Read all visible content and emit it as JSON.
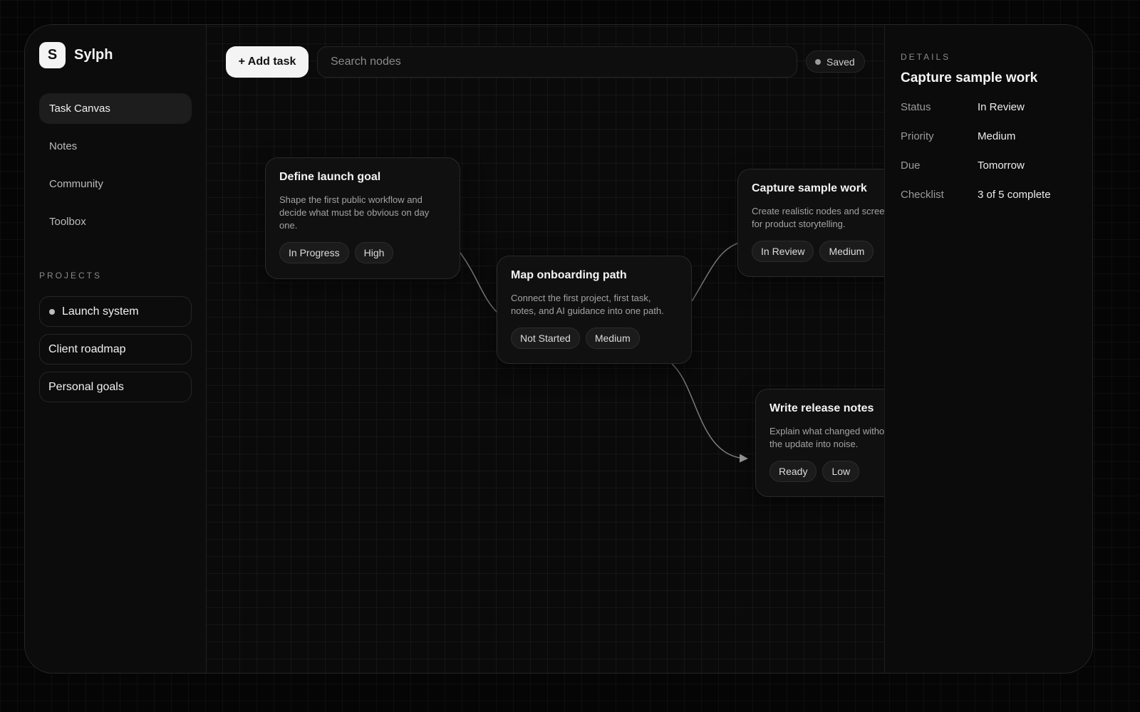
{
  "app": {
    "brand_initial": "S",
    "brand_name": "Sylph"
  },
  "nav": [
    {
      "label": "Task Canvas",
      "active": true
    },
    {
      "label": "Notes",
      "active": false
    },
    {
      "label": "Community",
      "active": false
    },
    {
      "label": "Toolbox",
      "active": false
    }
  ],
  "projects_label": "PROJECTS",
  "projects": [
    {
      "label": "Launch system",
      "active": true
    },
    {
      "label": "Client roadmap",
      "active": false
    },
    {
      "label": "Personal goals",
      "active": false
    }
  ],
  "toolbar": {
    "add_label": "+ Add task",
    "search_placeholder": "Search nodes",
    "saved_label": "Saved"
  },
  "cards": [
    {
      "title": "Define launch goal",
      "desc": "Shape the first public workflow and decide what must be obvious on day one.",
      "status": "In Progress",
      "priority": "High"
    },
    {
      "title": "Map onboarding path",
      "desc": "Connect the first project, first task, notes, and AI guidance into one path.",
      "status": "Not Started",
      "priority": "Medium"
    },
    {
      "title": "Capture sample work",
      "desc": "Create realistic nodes and screenshots for product storytelling.",
      "status": "In Review",
      "priority": "Medium"
    },
    {
      "title": "Write release notes",
      "desc": "Explain what changed without turning the update into noise.",
      "status": "Ready",
      "priority": "Low"
    }
  ],
  "details": {
    "label": "DETAILS",
    "title": "Capture sample work",
    "rows": [
      {
        "key": "Status",
        "value": "In Review"
      },
      {
        "key": "Priority",
        "value": "Medium"
      },
      {
        "key": "Due",
        "value": "Tomorrow"
      },
      {
        "key": "Checklist",
        "value": "3 of 5 complete"
      }
    ]
  },
  "colors": {
    "background": "#050505",
    "panel": "#0b0b0b",
    "accent": "#f4f4f4",
    "edge": "#7a7a7a"
  }
}
